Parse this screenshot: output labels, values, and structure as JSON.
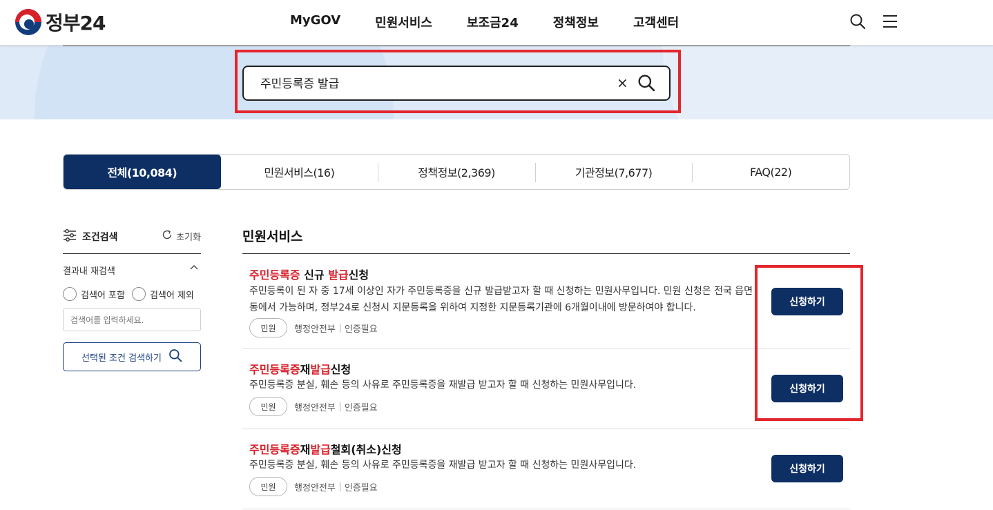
{
  "header": {
    "logo_text": "정부24",
    "nav": [
      "MyGOV",
      "민원서비스",
      "보조금24",
      "정책정보",
      "고객센터"
    ]
  },
  "search": {
    "value": "주민등록증 발급",
    "clear_label": "×"
  },
  "tabs": [
    {
      "label": "전체(10,084)",
      "active": true
    },
    {
      "label": "민원서비스(16)",
      "active": false
    },
    {
      "label": "정책정보(2,369)",
      "active": false
    },
    {
      "label": "기관정보(7,677)",
      "active": false
    },
    {
      "label": "FAQ(22)",
      "active": false
    }
  ],
  "sidebar": {
    "title": "조건검색",
    "reset": "초기화",
    "subsearch": "결과내 재검색",
    "radio_include": "검색어 포함",
    "radio_exclude": "검색어 제외",
    "input_placeholder": "검색어를 입력하세요.",
    "search_button": "선택된 조건 검색하기"
  },
  "results": {
    "section_title": "민원서비스",
    "items": [
      {
        "title_parts": [
          "주민등록증",
          " 신규 ",
          "발급",
          "신청"
        ],
        "description": "주민등록이 된 자 중 17세 이상인 자가 주민등록증을 신규 발급받고자 할 때 신청하는 민원사무입니다. 민원 신청은 전국 읍면동에서 가능하며, 정부24로 신청시 지문등록을 위하여 지정한 지문등록기관에 6개월이내에 방문하여야 합니다.",
        "chip": "민원",
        "agency": "행정안전부",
        "auth": "인증필요",
        "button": "신청하기"
      },
      {
        "title_parts": [
          "주민등록증",
          "재",
          "발급",
          "신청"
        ],
        "description": "주민등록증 분실, 훼손 등의 사유로 주민등록증을 재발급 받고자 할 때 신청하는 민원사무입니다.",
        "chip": "민원",
        "agency": "행정안전부",
        "auth": "인증필요",
        "button": "신청하기"
      },
      {
        "title_parts": [
          "주민등록증",
          "재",
          "발급",
          "철회(취소)신청"
        ],
        "description": "주민등록증 분실, 훼손 등의 사유로 주민등록증을 재발급 받고자 할 때 신청하는 민원사무입니다.",
        "chip": "민원",
        "agency": "행정안전부",
        "auth": "인증필요",
        "button": "신청하기"
      }
    ]
  },
  "colors": {
    "navy": "#0e2f64",
    "highlight_red": "#d8202a",
    "annotation_red": "#e3262e",
    "hero_bg": "#dfeaf8"
  }
}
